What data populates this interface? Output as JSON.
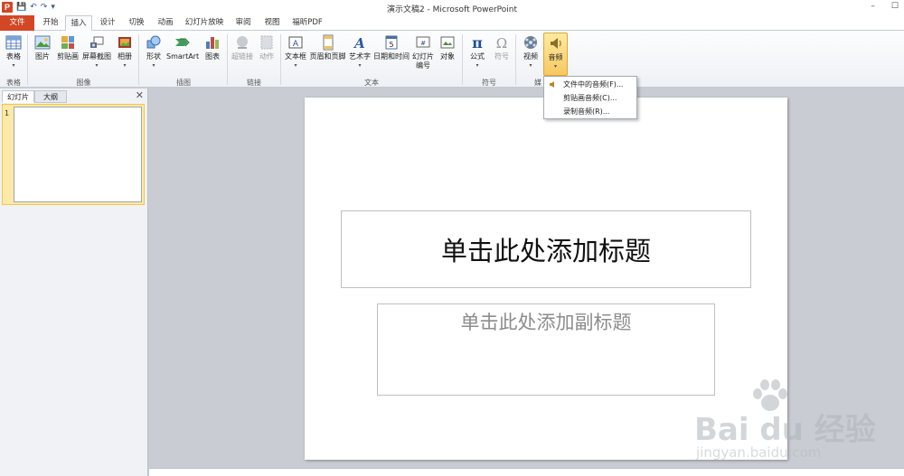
{
  "window": {
    "title": "演示文稿2 - Microsoft PowerPoint",
    "logo_letter": "P",
    "qat": [
      "💾",
      "↶",
      "↷",
      "▾"
    ],
    "controls": [
      "–",
      "☐"
    ]
  },
  "tabs": [
    {
      "label": "文件",
      "kind": "file"
    },
    {
      "label": "开始",
      "kind": "normal"
    },
    {
      "label": "插入",
      "kind": "active"
    },
    {
      "label": "设计",
      "kind": "normal"
    },
    {
      "label": "切换",
      "kind": "normal"
    },
    {
      "label": "动画",
      "kind": "normal"
    },
    {
      "label": "幻灯片放映",
      "kind": "normal"
    },
    {
      "label": "审阅",
      "kind": "normal"
    },
    {
      "label": "视图",
      "kind": "normal"
    },
    {
      "label": "福昕PDF",
      "kind": "normal"
    }
  ],
  "ribbon": {
    "buttons": [
      {
        "label": "表格",
        "sub": "▾",
        "icon": "table-icon",
        "disabled": false
      },
      {
        "label": "图片",
        "sub": "",
        "icon": "picture-icon",
        "disabled": false
      },
      {
        "label": "剪贴画",
        "sub": "",
        "icon": "clipart-icon",
        "disabled": false
      },
      {
        "label": "屏幕截图",
        "sub": "▾",
        "icon": "screenshot-icon",
        "disabled": false
      },
      {
        "label": "相册",
        "sub": "▾",
        "icon": "photo-album-icon",
        "disabled": false
      },
      {
        "label": "形状",
        "sub": "▾",
        "icon": "shapes-icon",
        "disabled": false
      },
      {
        "label": "SmartArt",
        "sub": "",
        "icon": "smartart-icon",
        "disabled": false
      },
      {
        "label": "图表",
        "sub": "",
        "icon": "chart-icon",
        "disabled": false
      },
      {
        "label": "超链接",
        "sub": "",
        "icon": "hyperlink-icon",
        "disabled": true
      },
      {
        "label": "动作",
        "sub": "",
        "icon": "action-icon",
        "disabled": true
      },
      {
        "label": "文本框",
        "sub": "▾",
        "icon": "textbox-icon",
        "disabled": false
      },
      {
        "label": "页眉和页脚",
        "sub": "",
        "icon": "header-footer-icon",
        "disabled": false
      },
      {
        "label": "艺术字",
        "sub": "▾",
        "icon": "wordart-icon",
        "disabled": false
      },
      {
        "label": "日期和时间",
        "sub": "",
        "icon": "date-time-icon",
        "disabled": false
      },
      {
        "label": "幻灯片编号",
        "sub": "",
        "icon": "slide-number-icon",
        "disabled": false
      },
      {
        "label": "对象",
        "sub": "",
        "icon": "object-icon",
        "disabled": false
      },
      {
        "label": "公式",
        "sub": "▾",
        "icon": "equation-icon",
        "disabled": false
      },
      {
        "label": "符号",
        "sub": "",
        "icon": "symbol-icon",
        "disabled": true
      },
      {
        "label": "视频",
        "sub": "▾",
        "icon": "video-icon",
        "disabled": false
      },
      {
        "label": "音频",
        "sub": "▾",
        "icon": "audio-icon",
        "disabled": false
      }
    ],
    "groups": [
      "表格",
      "图像",
      "插图",
      "链接",
      "文本",
      "符号",
      "媒"
    ]
  },
  "audio_menu": {
    "items": [
      "文件中的音频(F)...",
      "剪贴画音频(C)...",
      "录制音频(R)..."
    ]
  },
  "left_panel": {
    "tabs": [
      "幻灯片",
      "大纲"
    ],
    "close": "✕",
    "slide_number": "1"
  },
  "slide": {
    "title_placeholder": "单击此处添加标题",
    "subtitle_placeholder": "单击此处添加副标题"
  },
  "watermark": {
    "brand": "Bai du 经验",
    "url": "jingyan.baidu.com"
  }
}
